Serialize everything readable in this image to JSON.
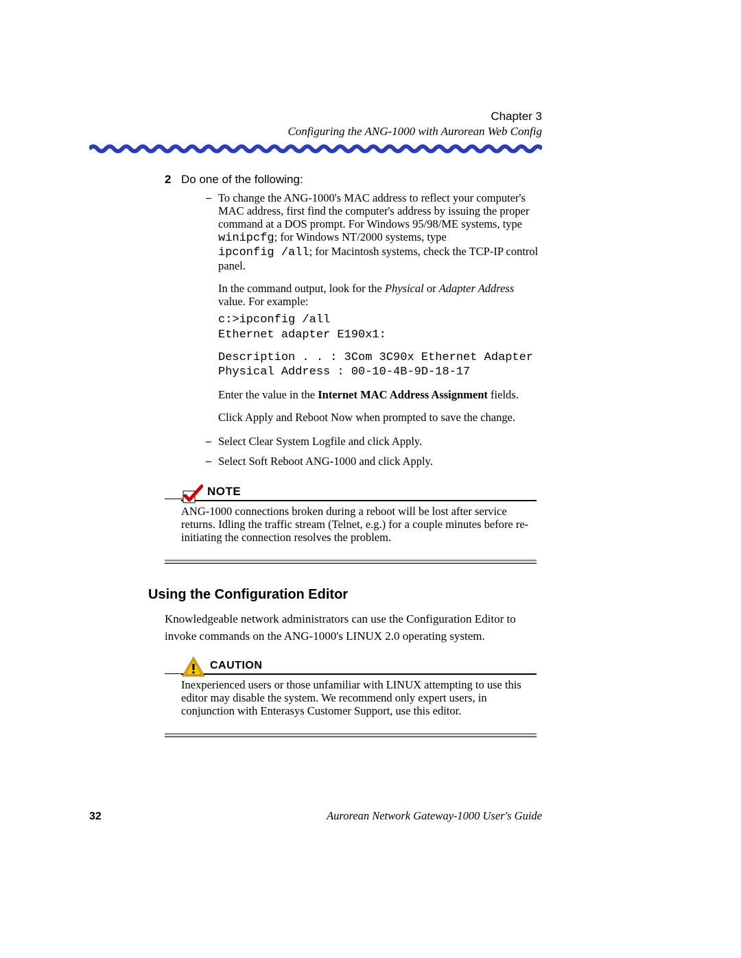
{
  "header": {
    "chapter": "Chapter 3",
    "subtitle": "Configuring the ANG-1000 with Aurorean Web Config"
  },
  "step": {
    "num": "2",
    "text": "Do one of the following:"
  },
  "bullet1": {
    "p1_a": "To change the ANG-1000's MAC address to reflect your computer's MAC address, first find the computer's address by issuing the proper command at a DOS prompt. For Windows 95/98/ME systems, type ",
    "cmd1": "winipcfg",
    "p1_b": "; for Windows NT/2000 systems, type ",
    "cmd2": "ipconfig /all",
    "p1_c": "; for Macintosh systems, check the TCP-IP control panel.",
    "p2_a": "In the command output, look for the ",
    "p2_i1": "Physical",
    "p2_b": " or ",
    "p2_i2": "Adapter Address",
    "p2_c": " value. For example:",
    "code1": "c:>ipconfig /all\nEthernet adapter E190x1:",
    "code2": "Description . . : 3Com 3C90x Ethernet Adapter\nPhysical Address : 00-10-4B-9D-18-17",
    "p3_a": "Enter the value in the ",
    "p3_bold": "Internet MAC Address Assignment",
    "p3_b": " fields.",
    "p4": "Click Apply and Reboot Now when prompted to save the change."
  },
  "bullet2": "Select Clear System Logfile and click Apply.",
  "bullet3": "Select Soft Reboot ANG-1000 and click Apply.",
  "note": {
    "label": "Note",
    "text": "ANG-1000 connections broken during a reboot will be lost after service returns. Idling the traffic stream (Telnet, e.g.) for a couple minutes before re-initiating the connection resolves the problem."
  },
  "section": {
    "heading": "Using the Configuration Editor",
    "text": "Knowledgeable network administrators can use the Configuration Editor to invoke commands on the ANG-1000's LINUX 2.0 operating system."
  },
  "caution": {
    "label": "Caution",
    "text": "Inexperienced users or those unfamiliar with LINUX attempting to use this editor may disable the system. We recommend only expert users, in conjunction with Enterasys Customer Support, use this editor."
  },
  "footer": {
    "page": "32",
    "guide": "Aurorean Network Gateway-1000 User's Guide"
  }
}
